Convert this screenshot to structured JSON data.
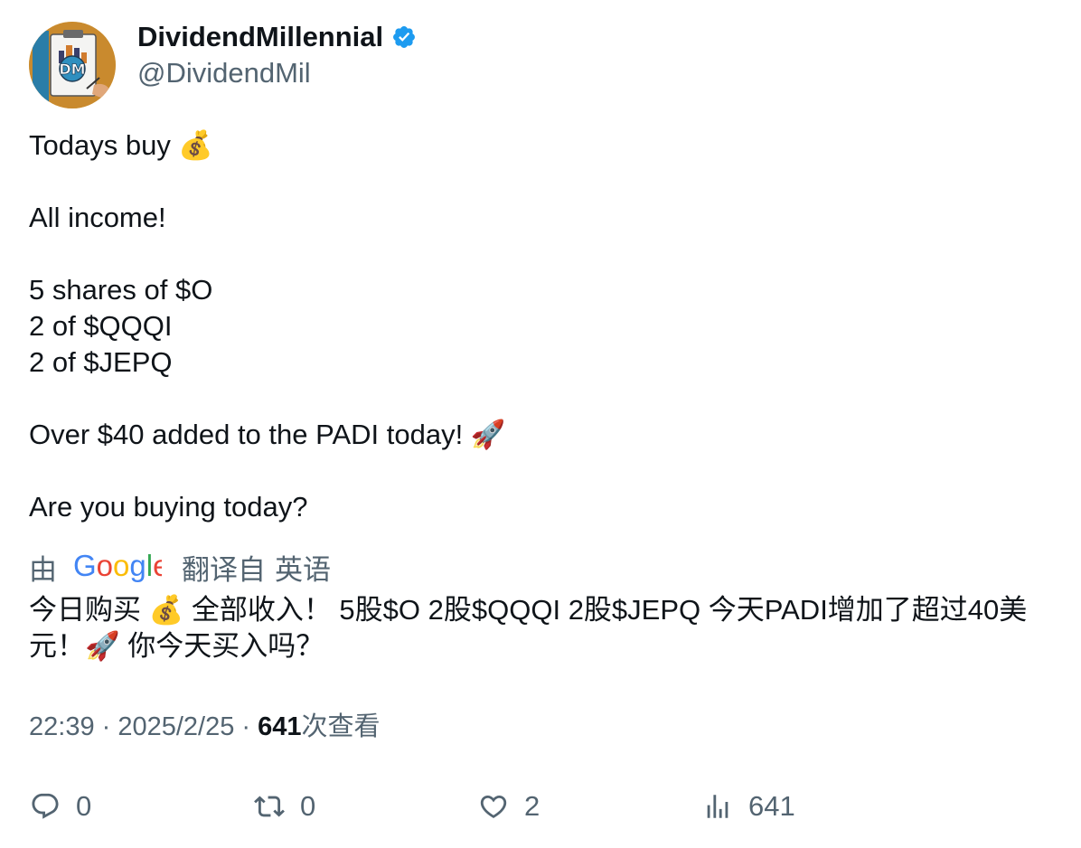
{
  "author": {
    "display_name": "DividendMillennial",
    "handle": "@DividendMil",
    "verified": true,
    "avatar_text": "DM",
    "verified_color": "#1d9bf0"
  },
  "tweet": {
    "lines": [
      "Todays buy 💰",
      "",
      "All income!",
      "",
      "5 shares of $O",
      "2 of $QQQI",
      "2 of $JEPQ",
      "",
      "Over $40 added to the PADI today! 🚀",
      "",
      "Are you buying today?"
    ]
  },
  "translation": {
    "by_label": "由",
    "provider": "Google",
    "from_label": "翻译自",
    "language": "英语",
    "text": "今日购买 💰 全部收入！ 5股$O 2股$QQQI 2股$JEPQ 今天PADI增加了超过40美元！🚀 你今天买入吗？"
  },
  "meta": {
    "time": "22:39",
    "separator": " · ",
    "date": "2025/2/25",
    "views_count": "641",
    "views_label": "次查看"
  },
  "actions": {
    "reply_count": "0",
    "retweet_count": "0",
    "like_count": "2",
    "views_count": "641"
  },
  "icons": {
    "reply": "reply-bubble-icon",
    "retweet": "retweet-icon",
    "like": "heart-icon",
    "views": "bar-chart-icon",
    "verified": "verified-badge-icon"
  },
  "colors": {
    "text_primary": "#0f1419",
    "text_secondary": "#536471",
    "google_blue": "#4285F4",
    "google_red": "#EA4335",
    "google_yellow": "#FBBC05",
    "google_green": "#34A853"
  }
}
